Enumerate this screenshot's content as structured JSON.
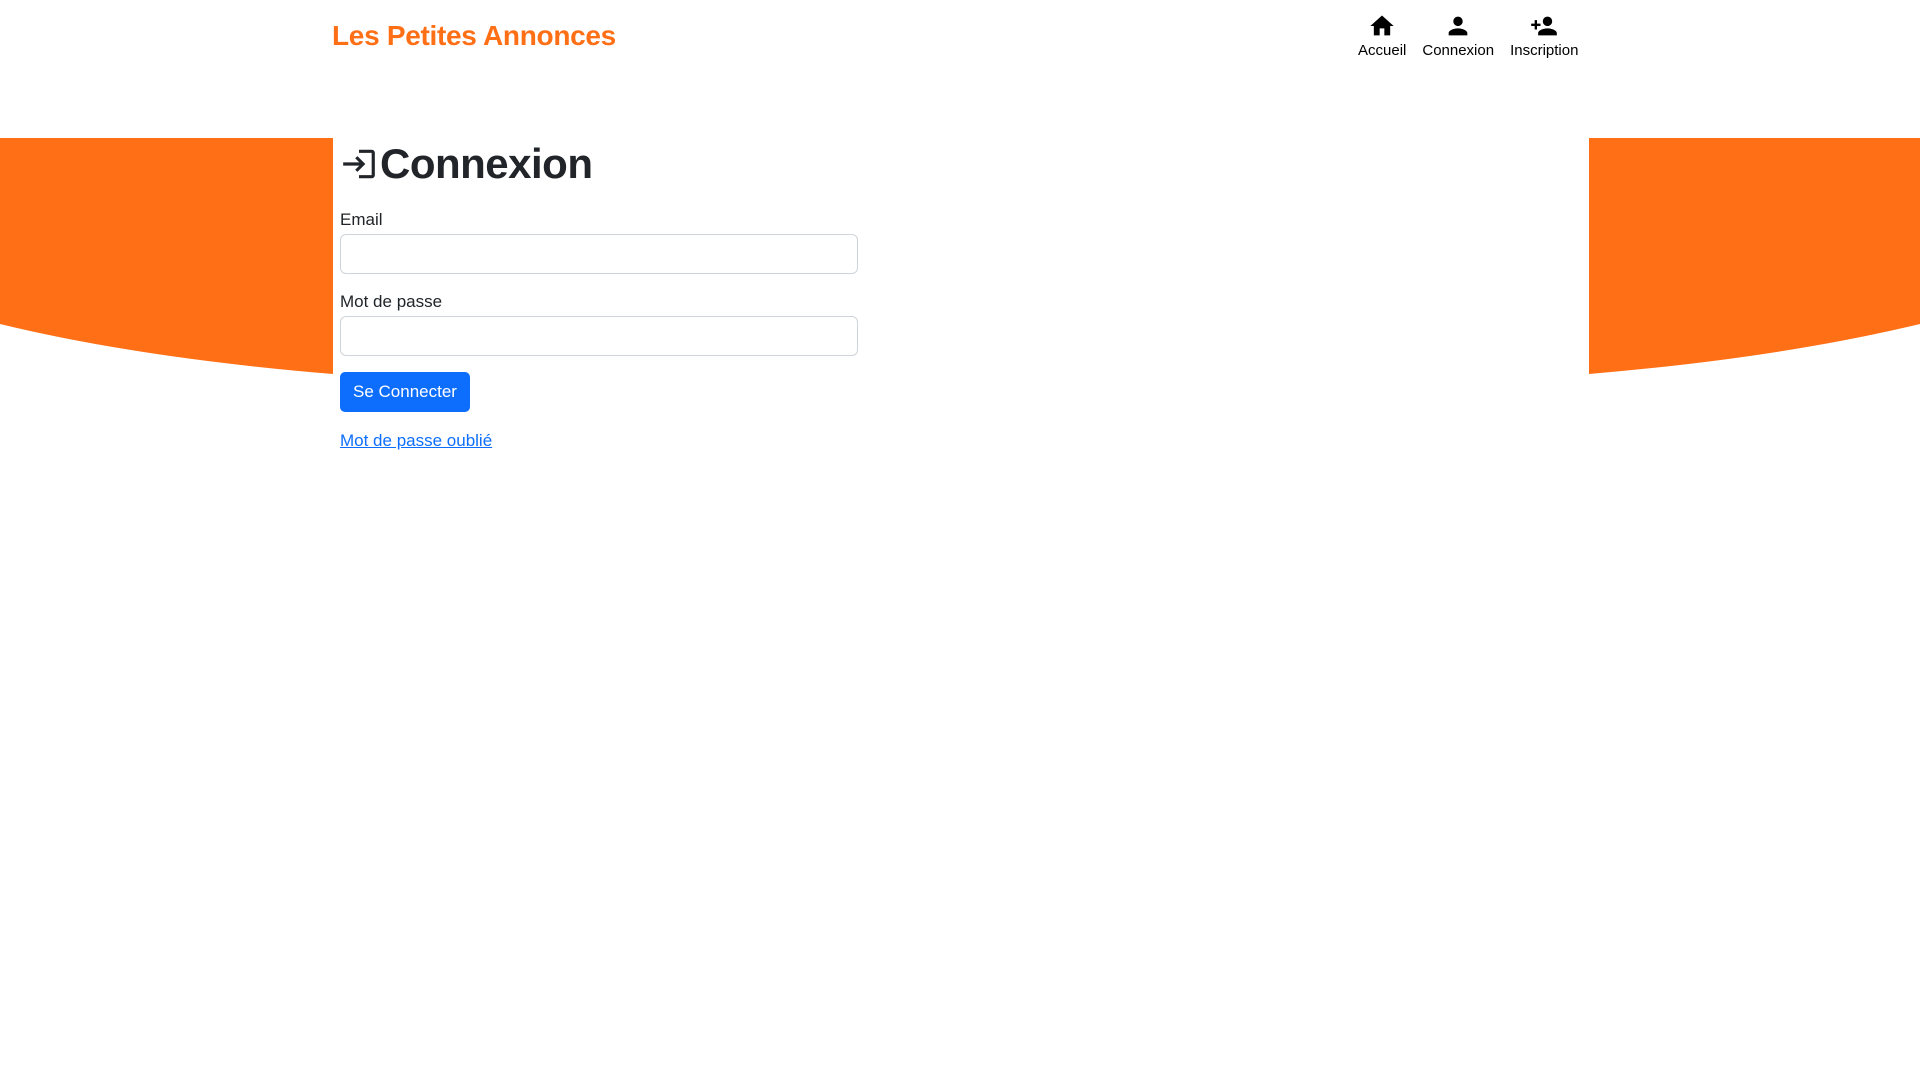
{
  "header": {
    "brand": "Les Petites Annonces",
    "nav": [
      {
        "label": "Accueil",
        "icon": "home-icon"
      },
      {
        "label": "Connexion",
        "icon": "person-icon"
      },
      {
        "label": "Inscription",
        "icon": "person-add-icon"
      }
    ]
  },
  "login": {
    "title": "Connexion",
    "title_icon": "login-icon",
    "email_label": "Email",
    "email_value": "",
    "password_label": "Mot de passe",
    "password_value": "",
    "submit_label": "Se Connecter",
    "forgot_link": "Mot de passe oublié"
  },
  "colors": {
    "brand": "#ff6f16",
    "accent_shape": "#ff6f16",
    "primary_button": "#0d6efd",
    "link": "#0d6efd"
  }
}
